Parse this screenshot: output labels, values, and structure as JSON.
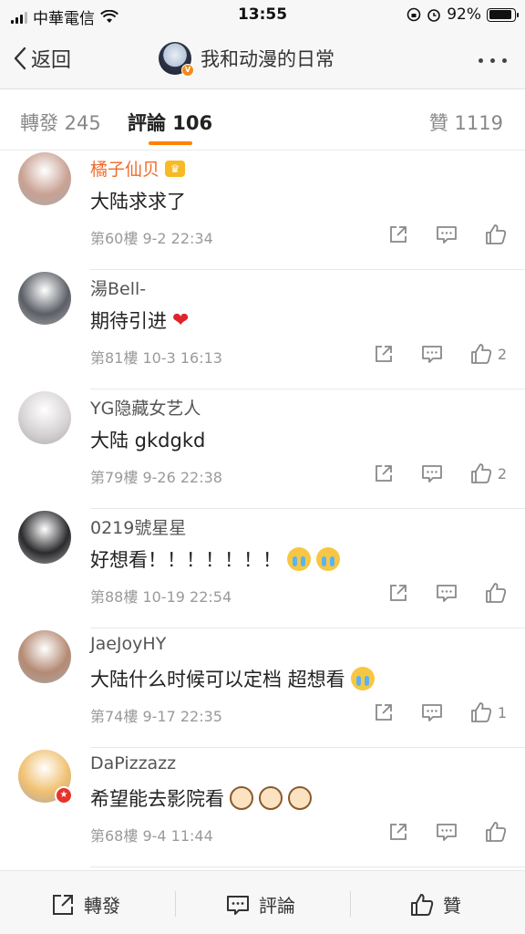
{
  "status_bar": {
    "carrier": "中華電信",
    "time": "13:55",
    "battery": "92%",
    "battery_level": 0.92
  },
  "nav": {
    "back_label": "返回",
    "title": "我和动漫的日常"
  },
  "tabs": {
    "repost": "轉發 245",
    "comment": "評論 106",
    "like": "贊 1119"
  },
  "comments": [
    {
      "name": "橘子仙贝",
      "text": "大陆求求了",
      "meta": "第60樓 9-2 22:34",
      "likes": "",
      "avatar_color": "#c9a193"
    },
    {
      "name": "湯Bell-",
      "text": "期待引进",
      "meta": "第81樓 10-3 16:13",
      "likes": "2",
      "avatar_color": "#5b5f66"
    },
    {
      "name": "YG隐藏女艺人",
      "text": "大陆 gkdgkd",
      "meta": "第79樓 9-26 22:38",
      "likes": "2",
      "avatar_color": "#d8d4d6"
    },
    {
      "name": "0219號星星",
      "text": "好想看！！！！！！！",
      "meta": "第88樓 10-19 22:54",
      "likes": "",
      "avatar_color": "#2b2b2e"
    },
    {
      "name": "JaeJoyHY",
      "text": "大陆什么时候可以定档 超想看",
      "meta": "第74樓 9-17 22:35",
      "likes": "1",
      "avatar_color": "#b58a73"
    },
    {
      "name": "DaPizzazz",
      "text": "希望能去影院看",
      "meta": "第68樓 9-4 11:44",
      "likes": "",
      "avatar_color": "#f0c070"
    }
  ],
  "bottom_bar": {
    "repost": "轉發",
    "comment": "評論",
    "like": "贊"
  }
}
